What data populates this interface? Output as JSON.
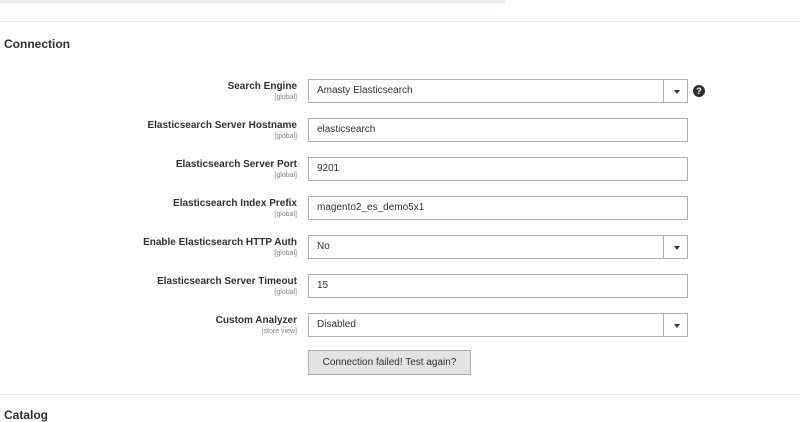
{
  "sections": {
    "connection_title": "Connection",
    "catalog_title": "Catalog"
  },
  "fields": [
    {
      "label": "Search Engine",
      "scope": "[global]",
      "value": "Amasty Elasticsearch",
      "type": "select"
    },
    {
      "label": "Elasticsearch Server Hostname",
      "scope": "[global]",
      "value": "elasticsearch",
      "type": "input"
    },
    {
      "label": "Elasticsearch Server Port",
      "scope": "[global]",
      "value": "9201",
      "type": "input"
    },
    {
      "label": "Elasticsearch Index Prefix",
      "scope": "[global]",
      "value": "magento2_es_demo5x1",
      "type": "input"
    },
    {
      "label": "Enable Elasticsearch HTTP Auth",
      "scope": "[global]",
      "value": "No",
      "type": "select"
    },
    {
      "label": "Elasticsearch Server Timeout",
      "scope": "[global]",
      "value": "15",
      "type": "input"
    },
    {
      "label": "Custom Analyzer",
      "scope": "[store view]",
      "value": "Disabled",
      "type": "select"
    }
  ],
  "help_icon": {
    "icon": "question-icon",
    "glyph": "?"
  },
  "test_button": {
    "label": "Connection failed! Test again?"
  }
}
